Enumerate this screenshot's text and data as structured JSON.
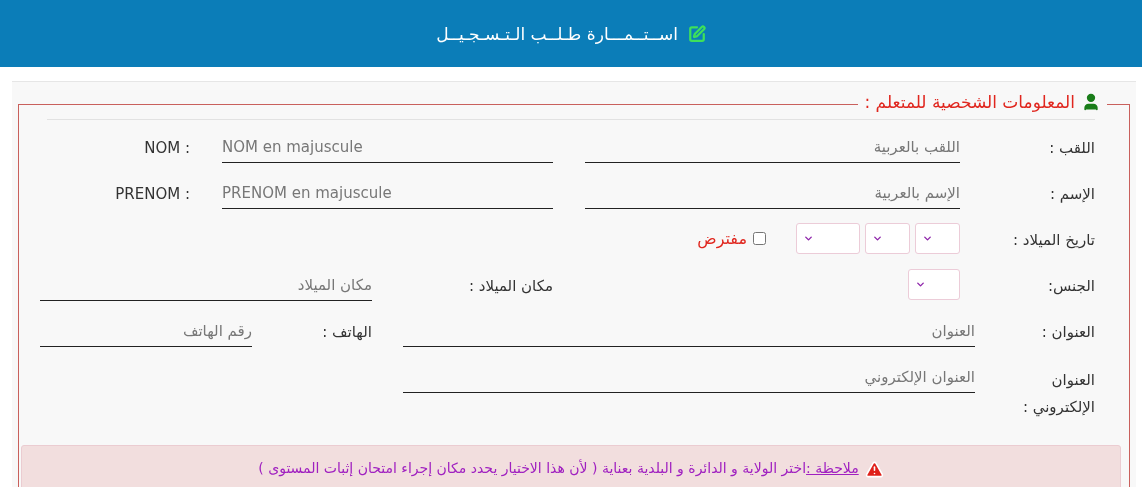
{
  "header": {
    "title": "اســتــمـــارة طـلــب الـتـسـجـيــل"
  },
  "section": {
    "title": "المعلومات الشخصية للمتعلم :"
  },
  "surname": {
    "label": "اللقب :",
    "placeholder": "اللقب بالعربية",
    "label_fr": "NOM :",
    "placeholder_fr": "NOM en majuscule"
  },
  "first_name": {
    "label": "الإسم :",
    "placeholder": "الإسم بالعربية",
    "label_fr": "PRENOM :",
    "placeholder_fr": "PRENOM en majuscule"
  },
  "birth_date": {
    "label": "تاريخ الميلاد :",
    "presumed": {
      "label": "مفترض",
      "checked": false
    }
  },
  "gender": {
    "label": "الجنس:"
  },
  "birth_place": {
    "label": "مكان الميلاد :",
    "placeholder": "مكان الميلاد"
  },
  "address": {
    "label": "العنوان :",
    "placeholder": "العنوان"
  },
  "phone": {
    "label": "الهاتف :",
    "placeholder": "رقم الهاتف"
  },
  "email": {
    "label": "العنوان الإلكتروني :",
    "placeholder": "العنوان الإلكتروني"
  },
  "note": {
    "label": "ملاحظة :",
    "text": "اختر الولاية و الدائرة و البلدية بعناية ( لأن هذا الاختيار يحدد مكان إجراء امتحان إثبات المستوى )"
  }
}
